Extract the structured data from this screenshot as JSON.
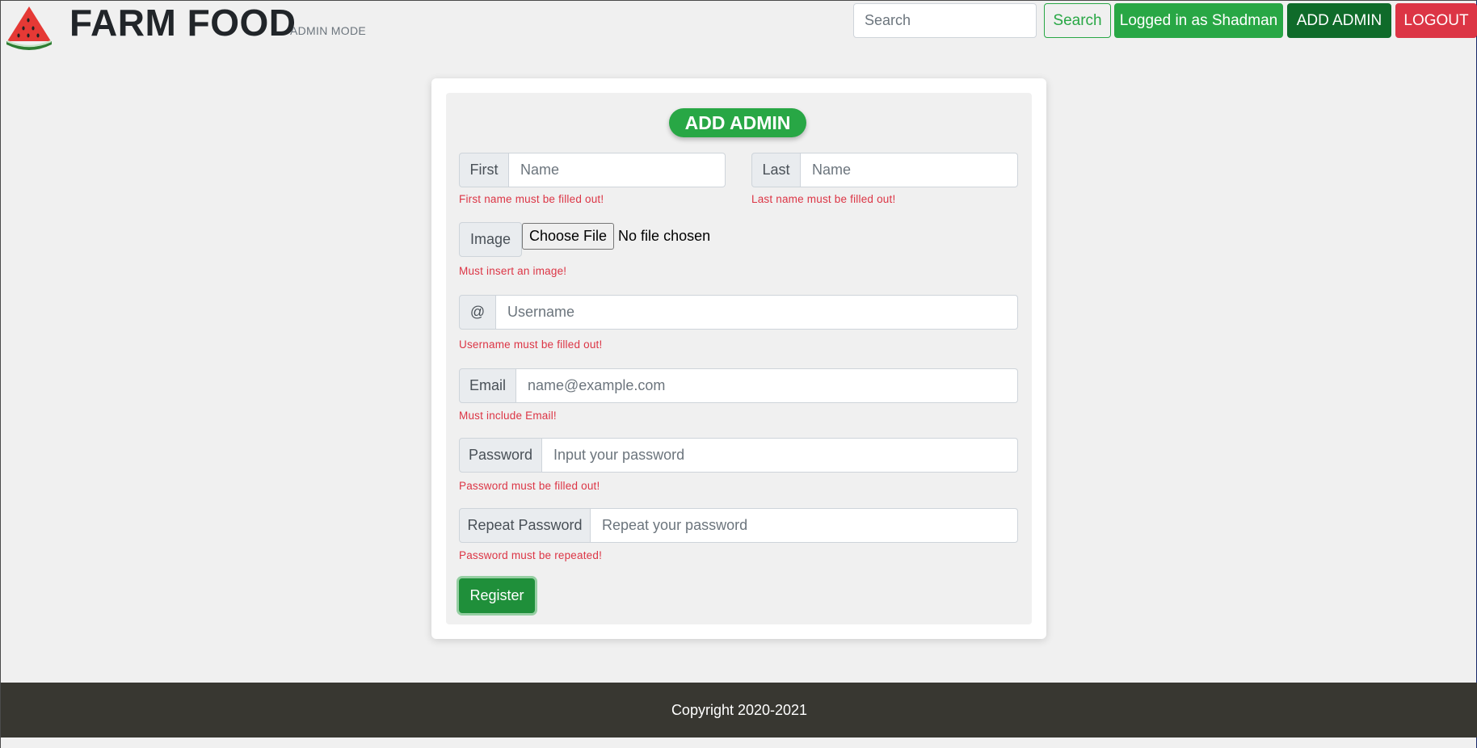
{
  "brand": {
    "title": "FARM FOOD",
    "subtitle": "ADMIN MODE",
    "logo": "watermelon-slice-icon"
  },
  "nav": {
    "search_placeholder": "Search",
    "search_button": "Search",
    "logged_in": "Logged in as Shadman",
    "add_admin": "ADD ADMIN",
    "logout": "LOGOUT"
  },
  "form": {
    "heading": "ADD ADMIN",
    "first": {
      "addon": "First",
      "placeholder": "Name",
      "error": "First name must be filled out!"
    },
    "last": {
      "addon": "Last",
      "placeholder": "Name",
      "error": "Last name must be filled out!"
    },
    "image": {
      "addon": "Image",
      "button": "Choose File",
      "status": "No file chosen",
      "error": "Must insert an image!"
    },
    "username": {
      "addon": "@",
      "placeholder": "Username",
      "error": "Username must be filled out!"
    },
    "email": {
      "addon": "Email",
      "placeholder": "name@example.com",
      "error": "Must include Email!"
    },
    "password": {
      "addon": "Password",
      "placeholder": "Input your password",
      "error": "Password must be filled out!"
    },
    "repeat": {
      "addon": "Repeat Password",
      "placeholder": "Repeat your password",
      "error": "Password must be repeated!"
    },
    "submit": "Register"
  },
  "footer": {
    "copyright": "Copyright 2020-2021"
  },
  "colors": {
    "success": "#28a745",
    "success_dark": "#0f6b2a",
    "danger": "#dc3545",
    "footer_bg": "#383731",
    "page_bg": "#f0f0f0"
  }
}
